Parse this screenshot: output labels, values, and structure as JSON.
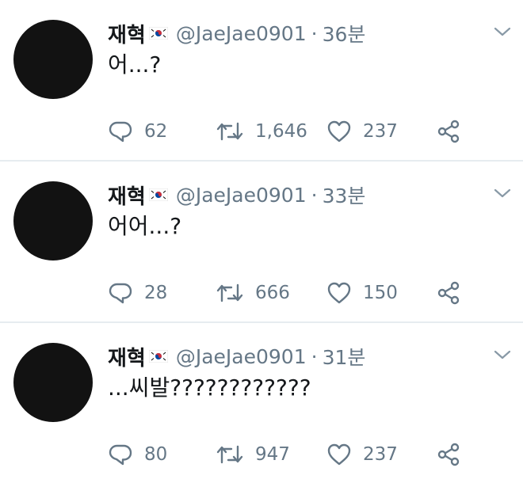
{
  "colors": {
    "text": "#14171a",
    "secondary": "#657786",
    "divider": "#e6ecf0",
    "avatar": "#121212"
  },
  "icons": {
    "reply": "reply-icon",
    "retweet": "retweet-icon",
    "like": "like-icon",
    "share": "share-icon",
    "more": "chevron-down-icon",
    "flag": "korea-flag-icon"
  },
  "tweets": [
    {
      "name": "재혁",
      "handle": "@JaeJae0901",
      "separator": "·",
      "time": "36분",
      "text": "어...?",
      "replies": "62",
      "retweets": "1,646",
      "likes": "237"
    },
    {
      "name": "재혁",
      "handle": "@JaeJae0901",
      "separator": "·",
      "time": "33분",
      "text": "어어...?",
      "replies": "28",
      "retweets": "666",
      "likes": "150"
    },
    {
      "name": "재혁",
      "handle": "@JaeJae0901",
      "separator": "·",
      "time": "31분",
      "text": "...씨발????????????",
      "replies": "80",
      "retweets": "947",
      "likes": "237"
    }
  ]
}
